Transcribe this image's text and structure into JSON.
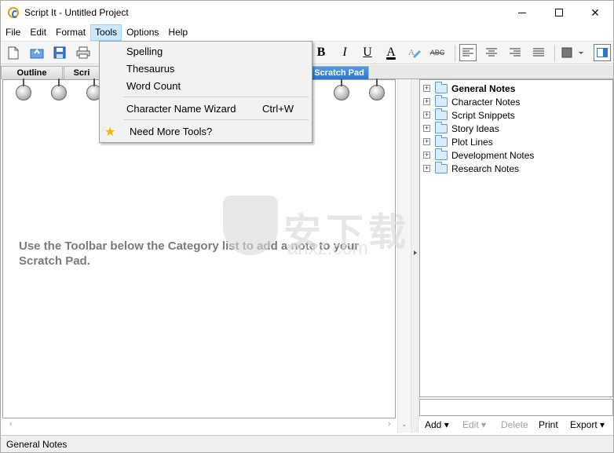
{
  "window": {
    "title": "Script It - Untitled Project"
  },
  "menu": [
    "File",
    "Edit",
    "Format",
    "Tools",
    "Options",
    "Help"
  ],
  "tabs": [
    {
      "label": "Outline"
    },
    {
      "label": "Scri"
    },
    {
      "label": "Scratch Pad"
    }
  ],
  "tools_menu": {
    "items": [
      {
        "label": "Spelling"
      },
      {
        "label": "Thesaurus"
      },
      {
        "label": "Word Count"
      },
      {
        "label": "Character Name Wizard",
        "shortcut": "Ctrl+W"
      },
      {
        "label": "Need More Tools?"
      }
    ]
  },
  "format_buttons": {
    "bold": "B",
    "italic": "I",
    "underline": "U",
    "font_color": "A",
    "strike": "ABC"
  },
  "notepad": {
    "hint": "Use the Toolbar below the Category list to add a note to your Scratch Pad."
  },
  "tree": {
    "items": [
      {
        "label": "General Notes",
        "bold": true
      },
      {
        "label": "Character Notes"
      },
      {
        "label": "Script Snippets"
      },
      {
        "label": "Story Ideas"
      },
      {
        "label": "Plot Lines"
      },
      {
        "label": "Development Notes"
      },
      {
        "label": "Research Notes"
      }
    ]
  },
  "right_buttons": {
    "add": "Add",
    "edit": "Edit",
    "delete": "Delete",
    "print": "Print",
    "export": "Export"
  },
  "status": {
    "text": "General Notes"
  },
  "watermark": {
    "big": "安下载",
    "small": "anxz.com"
  },
  "colors": {
    "active_tab": "#2d78cc",
    "menu_highlight": "#cce8ff",
    "star": "#f4b400"
  }
}
